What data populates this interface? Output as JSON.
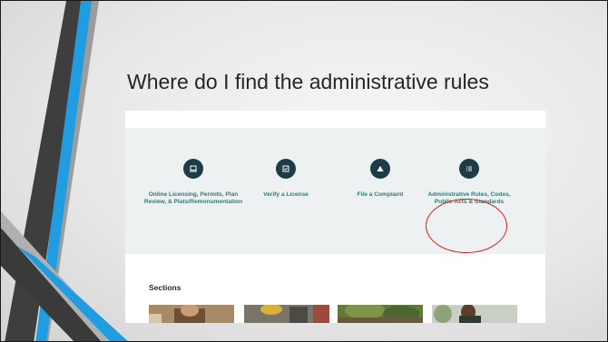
{
  "slide": {
    "title": "Where do I find the administrative rules"
  },
  "website": {
    "quick_links": [
      {
        "label": "Online Licensing, Permits, Plan Review, & Plats/Remonumentation",
        "icon": "laptop-icon"
      },
      {
        "label": "Verify a License",
        "icon": "checkbox-icon"
      },
      {
        "label": "File a Complaint",
        "icon": "warning-icon"
      },
      {
        "label": "Administrative Rules, Codes, Public Acts & Standards",
        "icon": "list-icon"
      }
    ],
    "highlighted_link": "Administrative Rules, Codes, Public Acts & Standards",
    "sections_heading": "Sections"
  },
  "colors": {
    "icon_circle": "#1c3d48",
    "link_text": "#2c7b78",
    "highlight": "#d61f1f",
    "accent_blue": "#1f9de0"
  }
}
